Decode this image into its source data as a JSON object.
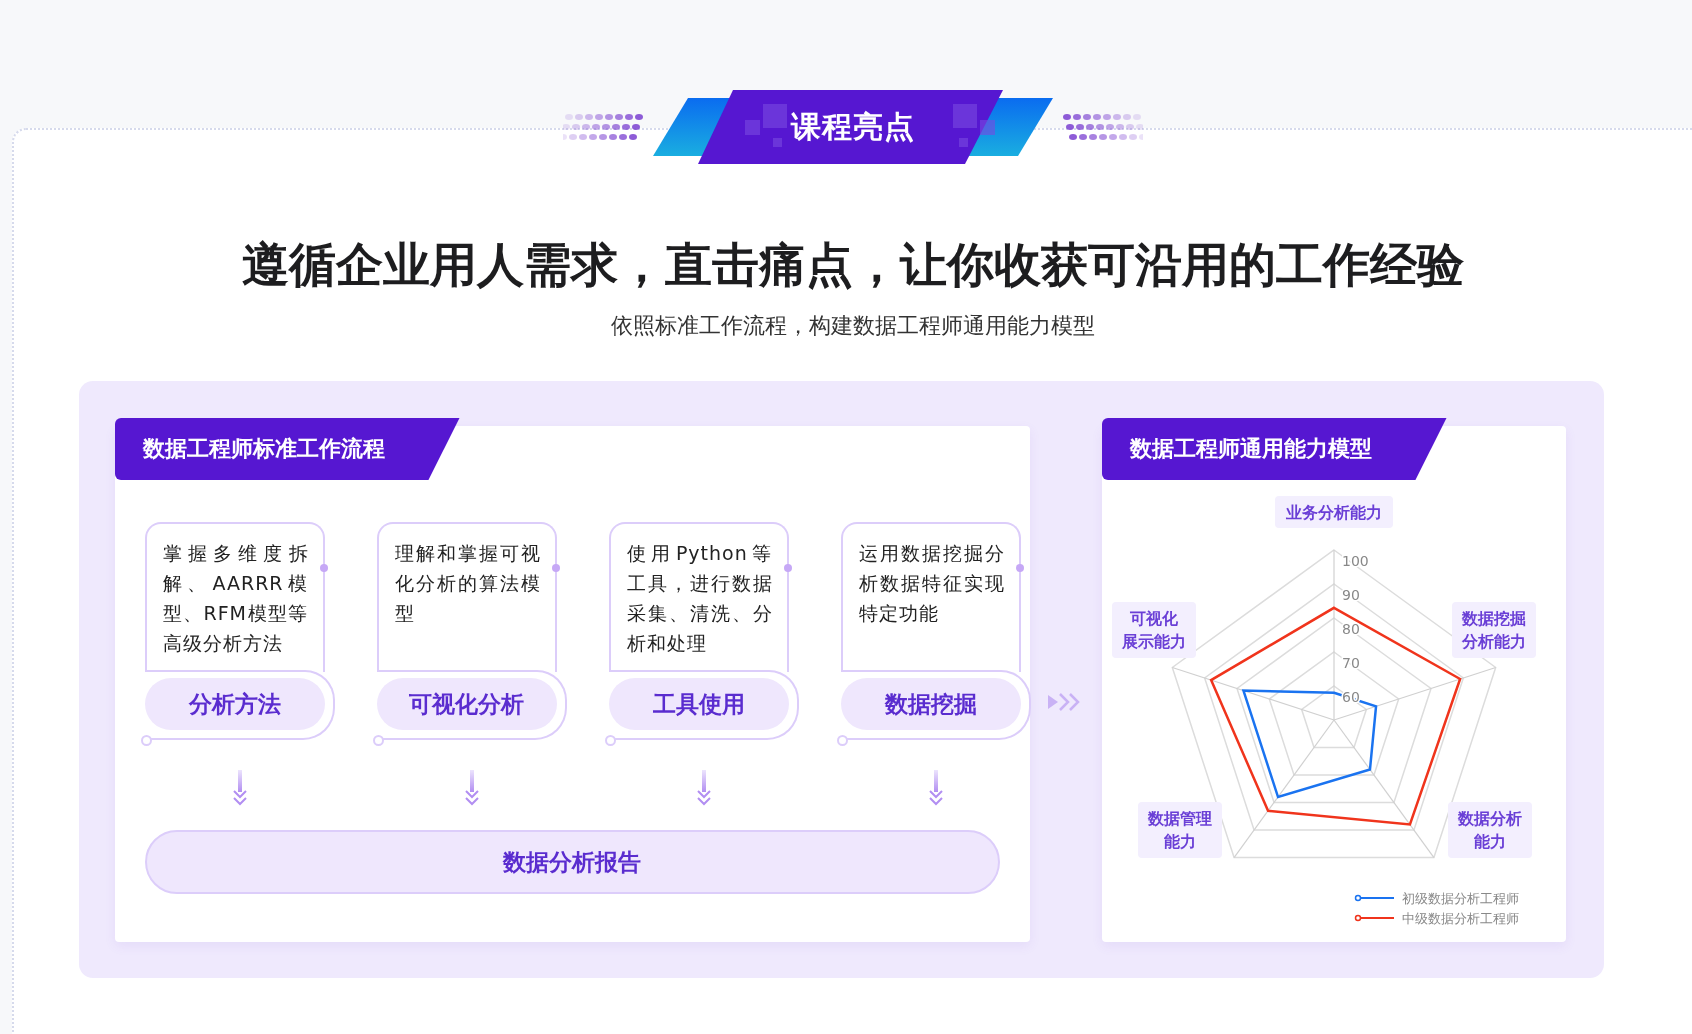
{
  "badge": {
    "title": "课程亮点"
  },
  "headline": "遵循企业用人需求，直击痛点，让你收获可沿用的工作经验",
  "subheadline": "依照标准工作流程，构建数据工程师通用能力模型",
  "workflow": {
    "title": "数据工程师标准工作流程",
    "steps": [
      {
        "description": "掌握多维度拆解、AARRR模型、RFM模型等高级分析方法",
        "label": "分析方法"
      },
      {
        "description": "理解和掌握可视化分析的算法模型",
        "label": "可视化分析"
      },
      {
        "description": "使用Python等工具，进行数据采集、清洗、分析和处理",
        "label": "工具使用"
      },
      {
        "description": "运用数据挖掘分析数据特征实现特定功能",
        "label": "数据挖掘"
      }
    ],
    "result": "数据分析报告"
  },
  "ability_model": {
    "title": "数据工程师通用能力模型",
    "chart_data": {
      "type": "radar",
      "categories": [
        "业务分析能力",
        "数据挖掘分析能力",
        "数据分析能力",
        "数据管理能力",
        "可视化展示能力"
      ],
      "series": [
        {
          "name": "初级数据分析工程师",
          "color": "#1a73f0",
          "values": [
            58,
            63,
            68,
            78,
            78
          ]
        },
        {
          "name": "中级数据分析工程师",
          "color": "#f0341c",
          "values": [
            83,
            89,
            88,
            83,
            88
          ]
        }
      ],
      "legend": "bottom-right",
      "ylim": [
        50,
        100
      ],
      "yticks": [
        60,
        70,
        80,
        90,
        100
      ]
    }
  }
}
